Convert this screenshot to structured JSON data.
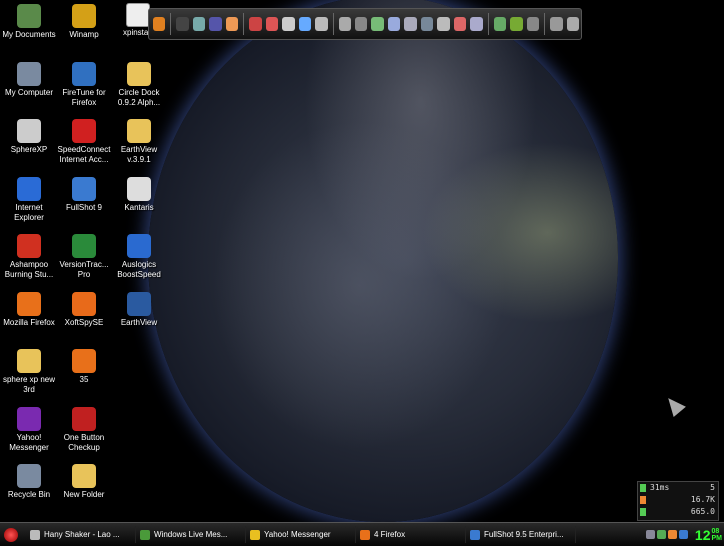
{
  "desktop_icons": [
    {
      "label": "My Documents",
      "icon": "documents-icon",
      "color": "#5a8a4a"
    },
    {
      "label": "Winamp",
      "icon": "winamp-icon",
      "color": "#d4a017"
    },
    {
      "label": "My Computer",
      "icon": "computer-icon",
      "color": "#7a8aa0"
    },
    {
      "label": "FireTune for Firefox",
      "icon": "firetune-icon",
      "color": "#3070c0"
    },
    {
      "label": "Circle Dock 0.9.2 Alph...",
      "icon": "folder-icon",
      "color": "#e8c35a"
    },
    {
      "label": "SphereXP",
      "icon": "sphere-icon",
      "color": "#cccccc"
    },
    {
      "label": "SpeedConnect Internet Acc...",
      "icon": "speedconnect-icon",
      "color": "#d02020"
    },
    {
      "label": "EarthView v.3.9.1",
      "icon": "folder-icon",
      "color": "#e8c35a"
    },
    {
      "label": "Internet Explorer",
      "icon": "ie-icon",
      "color": "#2a6bd6"
    },
    {
      "label": "FullShot 9",
      "icon": "fullshot-icon",
      "color": "#3a7ad0"
    },
    {
      "label": "Kantaris",
      "icon": "kantaris-icon",
      "color": "#dddddd"
    },
    {
      "label": "Ashampoo Burning Stu...",
      "icon": "ashampoo-icon",
      "color": "#d03020"
    },
    {
      "label": "VersionTrac... Pro",
      "icon": "versiontracker-icon",
      "color": "#2a8a3a"
    },
    {
      "label": "Auslogics BoostSpeed",
      "icon": "auslogics-icon",
      "color": "#2a6ad0"
    },
    {
      "label": "Mozilla Firefox",
      "icon": "firefox-icon",
      "color": "#e8701a"
    },
    {
      "label": "XoftSpySE",
      "icon": "xoftspy-icon",
      "color": "#e86a1a"
    },
    {
      "label": "EarthView",
      "icon": "earthview-icon",
      "color": "#2a5aa0"
    },
    {
      "label": "sphere xp new 3rd",
      "icon": "folder-icon",
      "color": "#e8c35a"
    },
    {
      "label": "35",
      "icon": "firefox-file-icon",
      "color": "#e8701a"
    },
    {
      "label": "Yahoo! Messenger",
      "icon": "yahoo-icon",
      "color": "#7a2ab0"
    },
    {
      "label": "One Button Checkup",
      "icon": "checkup-icon",
      "color": "#c02020"
    },
    {
      "label": "Recycle Bin",
      "icon": "recycle-bin-icon",
      "color": "#7a8aa0"
    },
    {
      "label": "New Folder",
      "icon": "folder-icon",
      "color": "#e8c35a"
    }
  ],
  "floating_icon": {
    "label": "xpinstall",
    "icon": "installer-icon"
  },
  "dock_colors": [
    "#e08020",
    "#444",
    "#7aa",
    "#55a",
    "#e95",
    "#c44",
    "#d55",
    "#ccc",
    "#6af",
    "#bbb",
    "#aaa",
    "#888",
    "#7b7",
    "#9ad",
    "#aab",
    "#789",
    "#bbb",
    "#d66",
    "#aac",
    "#6a6",
    "#7a3",
    "#888",
    "#999",
    "#aaa"
  ],
  "system_monitor": {
    "ping": "31ms",
    "ping_count": "5",
    "download": "16.7K",
    "upload": "665.0"
  },
  "taskbar": {
    "tasks": [
      {
        "label": "Hany Shaker - Lao ...",
        "icon": "media-icon",
        "color": "#bbbbbb"
      },
      {
        "label": "Windows Live Mes...",
        "icon": "live-messenger-icon",
        "color": "#4a9a3a"
      },
      {
        "label": "Yahoo! Messenger",
        "icon": "yahoo-icon",
        "color": "#e8c020"
      },
      {
        "label": "4 Firefox",
        "icon": "firefox-icon",
        "color": "#e8701a"
      },
      {
        "label": "FullShot 9.5 Enterpri...",
        "icon": "fullshot-icon",
        "color": "#3a7ad0"
      }
    ],
    "clock_hour": "12",
    "clock_min": "08",
    "clock_ampm": "PM"
  }
}
